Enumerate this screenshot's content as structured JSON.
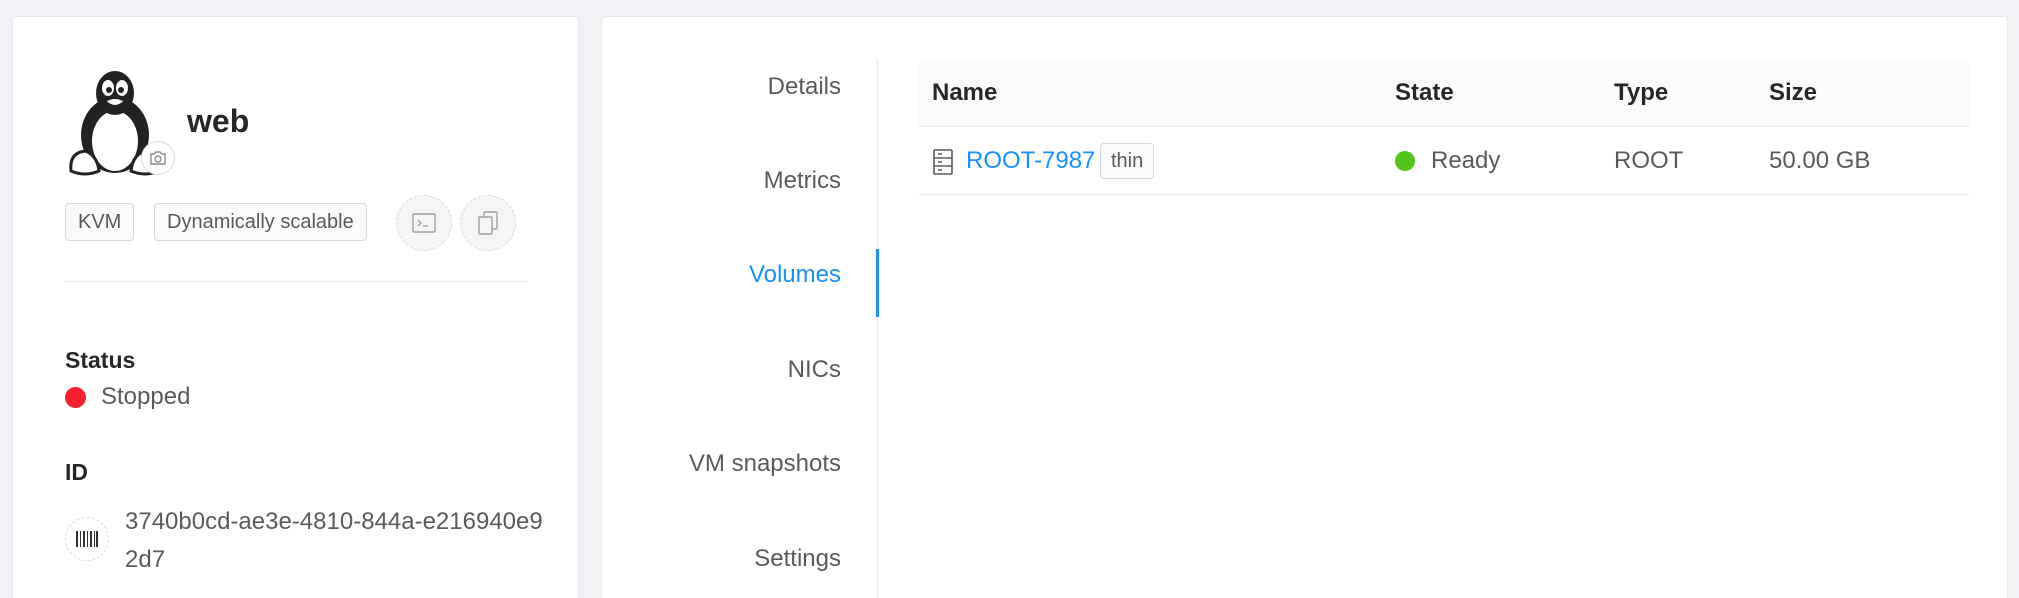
{
  "vm": {
    "name": "web",
    "tags": [
      "KVM",
      "Dynamically scalable"
    ],
    "status_label": "Status",
    "status": "Stopped",
    "status_color": "#f5222d",
    "id_label": "ID",
    "id": "3740b0cd-ae3e-4810-844a-e216940e92d7",
    "os_icon": "linux-tux-icon"
  },
  "tabs": [
    {
      "label": "Details",
      "active": false
    },
    {
      "label": "Metrics",
      "active": false
    },
    {
      "label": "Volumes",
      "active": true
    },
    {
      "label": "NICs",
      "active": false
    },
    {
      "label": "VM snapshots",
      "active": false
    },
    {
      "label": "Settings",
      "active": false
    }
  ],
  "volumes_table": {
    "columns": [
      "Name",
      "State",
      "Type",
      "Size"
    ],
    "rows": [
      {
        "name": "ROOT-7987",
        "tag": "thin",
        "state": "Ready",
        "state_color": "#52c41a",
        "type": "ROOT",
        "size": "50.00 GB"
      }
    ]
  },
  "colors": {
    "accent": "#1890ff",
    "ready": "#52c41a",
    "stopped": "#f5222d"
  }
}
